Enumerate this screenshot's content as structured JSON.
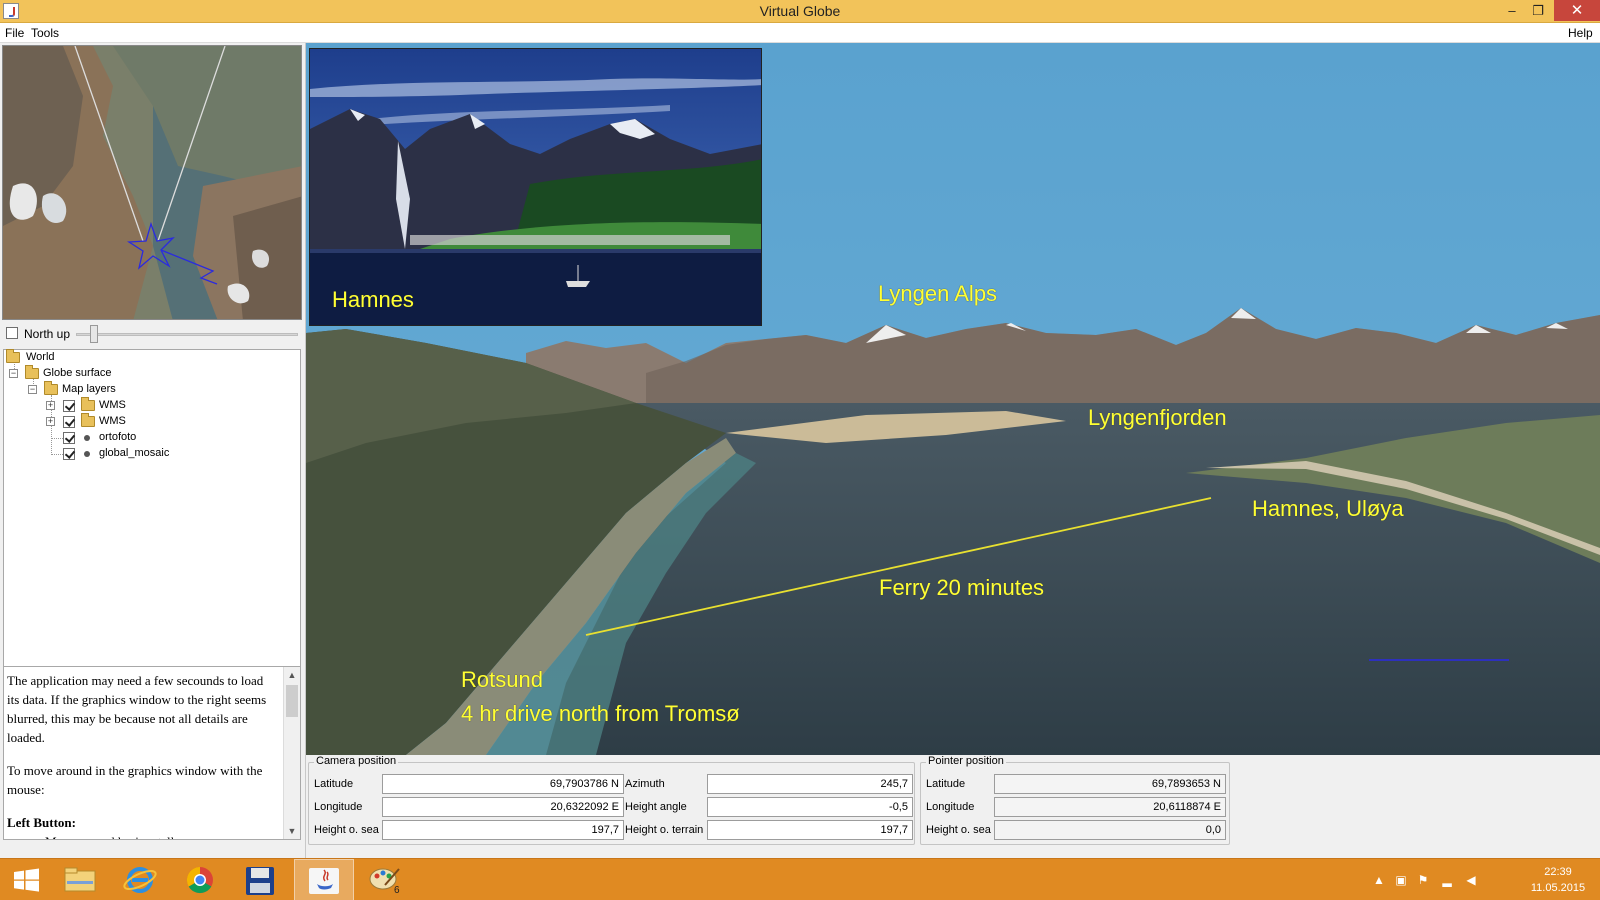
{
  "window": {
    "title": "Virtual Globe",
    "minimize": "–",
    "maximize": "❐",
    "close": "✕"
  },
  "menu": {
    "file": "File",
    "tools": "Tools",
    "help": "Help"
  },
  "overview": {
    "north_up_label": "North up",
    "north_up_checked": false
  },
  "layer_tree": {
    "world": "World",
    "globe_surface": "Globe surface",
    "map_layers": "Map layers",
    "wms_1": "WMS",
    "wms_2": "WMS",
    "ortofoto": "ortofoto",
    "global_mosaic": "global_mosaic"
  },
  "help_text": {
    "p1": "The application may need a few secounds to load its data. If the graphics window to the right seems blurred, this may be because not all details are loaded.",
    "p2": "To move around in the graphics window with the mouse:",
    "left_button": "Left Button:",
    "left_button_desc": "Move around horizontally"
  },
  "view_labels": {
    "hamnes_photo": "Hamnes",
    "lyngen_alps": "Lyngen Alps",
    "lyngenfjorden": "Lyngenfjorden",
    "hamnes_uloya": "Hamnes, Uløya",
    "ferry": "Ferry 20 minutes",
    "rotsund": "Rotsund",
    "drive": "4 hr drive north from Tromsø"
  },
  "camera": {
    "legend": "Camera position",
    "latitude_label": "Latitude",
    "latitude": "69,7903786 N",
    "longitude_label": "Longitude",
    "longitude": "20,6322092 E",
    "height_sea_label": "Height o. sea",
    "height_sea": "197,7",
    "azimuth_label": "Azimuth",
    "azimuth": "245,7",
    "height_angle_label": "Height angle",
    "height_angle": "-0,5",
    "height_terrain_label": "Height o. terrain",
    "height_terrain": "197,7"
  },
  "pointer": {
    "legend": "Pointer position",
    "latitude_label": "Latitude",
    "latitude": "69,7893653 N",
    "longitude_label": "Longitude",
    "longitude": "20,6118874 E",
    "height_sea_label": "Height o. sea",
    "height_sea": "0,0"
  },
  "taskbar": {
    "paint_badge": "6",
    "time": "22:39",
    "date": "11.05.2015"
  },
  "colors": {
    "title_bar": "#f2c35a",
    "taskbar": "#e08a22",
    "label_yellow": "#ffff33",
    "sky": "#5ea6d2"
  }
}
